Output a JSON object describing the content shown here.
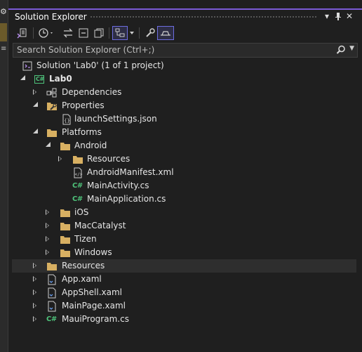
{
  "window": {
    "title": "Solution Explorer"
  },
  "title_controls": {
    "dropdown": "▾",
    "pin": "⊥",
    "close": "✕"
  },
  "search": {
    "placeholder": "Search Solution Explorer (Ctrl+;)"
  },
  "tree": {
    "solution": "Solution 'Lab0' (1 of 1 project)",
    "project": "Lab0",
    "dependencies": "Dependencies",
    "properties": "Properties",
    "launch_settings": "launchSettings.json",
    "platforms": "Platforms",
    "android": "Android",
    "android_resources": "Resources",
    "android_manifest": "AndroidManifest.xml",
    "main_activity": "MainActivity.cs",
    "main_application": "MainApplication.cs",
    "ios": "iOS",
    "maccatalyst": "MacCatalyst",
    "tizen": "Tizen",
    "windows": "Windows",
    "resources": "Resources",
    "app_xaml": "App.xaml",
    "appshell_xaml": "AppShell.xaml",
    "mainpage_xaml": "MainPage.xaml",
    "mauiprogram": "MauiProgram.cs",
    "cs_badge": "C#"
  },
  "colors": {
    "accent": "#7a5ad6",
    "folder": "#d8b062",
    "csharp": "#4ec27a",
    "background": "#1f1f1f",
    "selected_row": "#2e2e2e"
  },
  "icons": [
    "settings-icon",
    "home-sync-icon",
    "history-icon",
    "sync-icon",
    "collapse-all-icon",
    "copy-icon",
    "filter-icon",
    "properties-icon",
    "preview-icon",
    "search-icon"
  ]
}
